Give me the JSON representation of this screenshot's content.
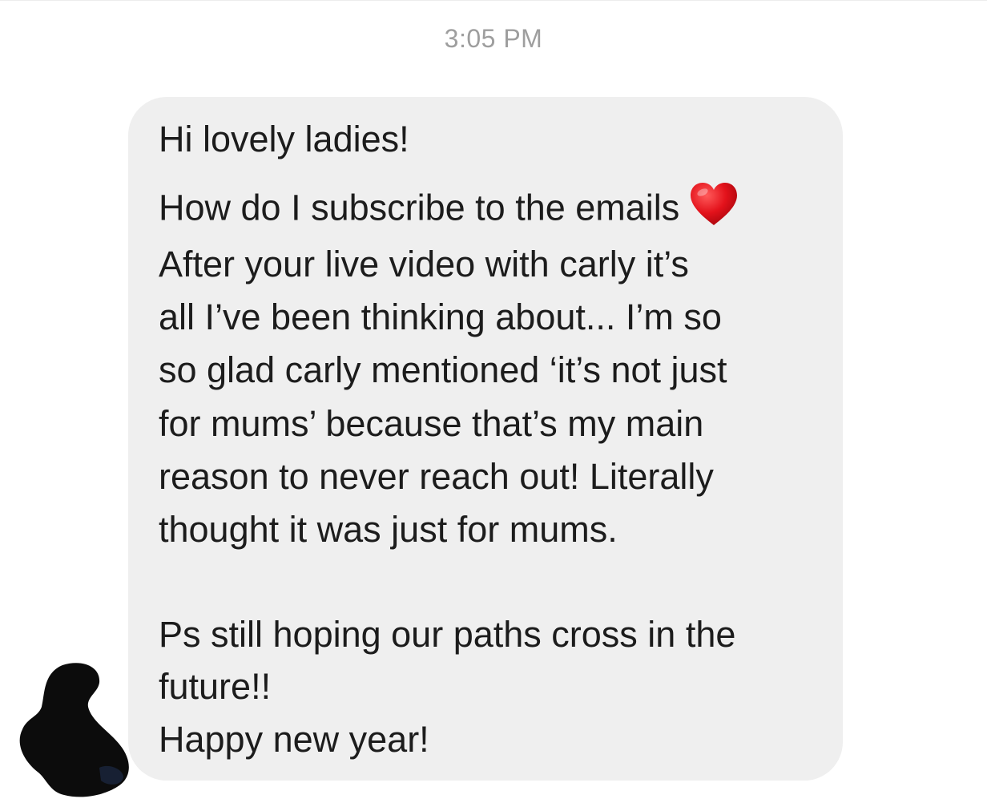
{
  "timestamp": "3:05 PM",
  "message": {
    "lines": [
      "Hi lovely ladies!",
      "How do I subscribe to the emails",
      "After your live video with carly it’s",
      "all I’ve been thinking about... I’m so",
      "so glad carly mentioned ‘it’s not just",
      "for mums’ because that’s my main",
      "reason to never reach out! Literally",
      "thought it was just for mums.",
      "Ps still hoping our paths cross in the",
      "future!!",
      "Happy new year!"
    ],
    "emoji": "heart-icon",
    "bubble_color": "#efefef",
    "text_color": "#1c1c1c"
  },
  "colors": {
    "timestamp": "#9e9e9e",
    "heart": "#e3121b"
  }
}
